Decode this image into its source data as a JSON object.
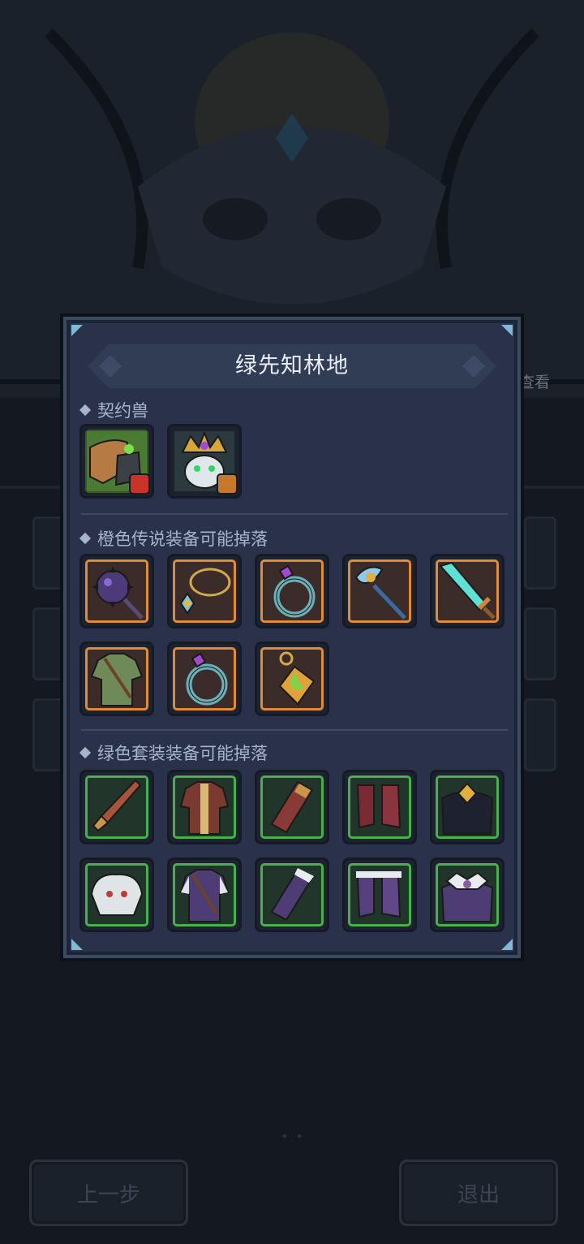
{
  "background": {
    "view_label": "查看",
    "prev_button": "上一步",
    "exit_button": "退出"
  },
  "modal": {
    "title": "绿先知林地",
    "sections": {
      "pets": {
        "label": "契约兽"
      },
      "orange": {
        "label": "橙色传说装备可能掉落"
      },
      "green": {
        "label": "绿色套装装备可能掉落"
      }
    },
    "pets": [
      {
        "icon": "beast-claw-icon",
        "badge": "fire-element-icon"
      },
      {
        "icon": "crowned-beast-icon",
        "badge": "earth-element-icon"
      }
    ],
    "orange_items": [
      "spiked-mace-icon",
      "necklace-icon",
      "ring-icon",
      "staff-icon",
      "crystal-sword-icon",
      "tunic-armor-icon",
      "ring-icon",
      "amulet-icon"
    ],
    "green_items": [
      "dagger-icon",
      "robe-armor-icon",
      "bracer-icon",
      "boots-icon",
      "cape-icon",
      "helmet-icon",
      "vest-armor-icon",
      "gauntlet-icon",
      "fur-boots-icon",
      "feather-cape-icon"
    ],
    "colors": {
      "orange_frame": "#e18a38",
      "green_frame": "#49b04e"
    }
  }
}
